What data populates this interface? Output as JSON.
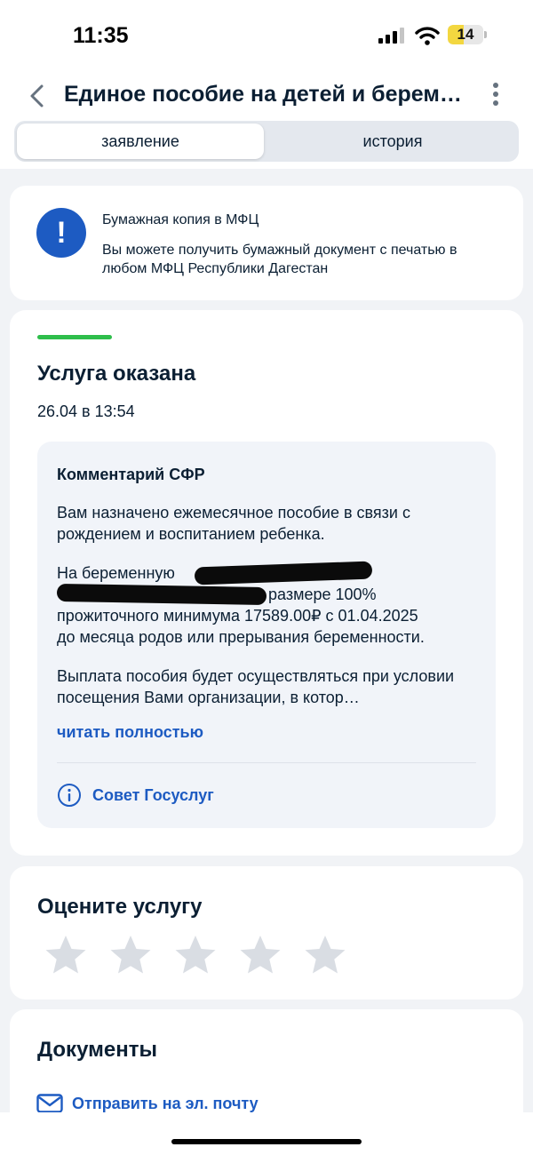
{
  "status_bar": {
    "time": "11:35",
    "battery_level": "14",
    "battery_fraction": 0.14,
    "icons": [
      "signal-icon",
      "wifi-icon",
      "battery-icon"
    ]
  },
  "header": {
    "title": "Единое пособие на детей и беременным",
    "tabs": [
      {
        "label": "заявление",
        "active": true
      },
      {
        "label": "история",
        "active": false
      }
    ]
  },
  "notice": {
    "title": "Бумажная копия в МФЦ",
    "text": "Вы можете получить бумажный документ с печатью в любом МФЦ Республики Дагестан",
    "icon": "exclamation-icon"
  },
  "status": {
    "title": "Услуга оказана",
    "date": "26.04 в 13:54",
    "progress_color": "#2ebe4b"
  },
  "comment": {
    "title": "Комментарий СФР",
    "p1": "Вам назначено ежемесячное пособие в связи с рождением и воспитанием ребенка.",
    "p2_line1": "На беременную",
    "p2_line2_tail": "размере 100%",
    "p2_line3": "прожиточного минимума 17589.00₽ с 01.04.2025",
    "p2_line4": "до месяца родов или прерывания беременности.",
    "p3": "Выплата пособия будет осуществляться при условии посещения Вами организации, в котор…",
    "read_more": "читать полностью",
    "advice": "Совет Госуслуг"
  },
  "rating": {
    "title": "Оцените услугу",
    "stars_total": 5,
    "stars_selected": 0
  },
  "documents": {
    "title": "Документы",
    "email_link": "Отправить на эл. почту"
  },
  "colors": {
    "accent": "#1d5bc2",
    "success": "#2ebe4b",
    "background": "#f1f3f6",
    "star_inactive": "#d9dde3"
  }
}
